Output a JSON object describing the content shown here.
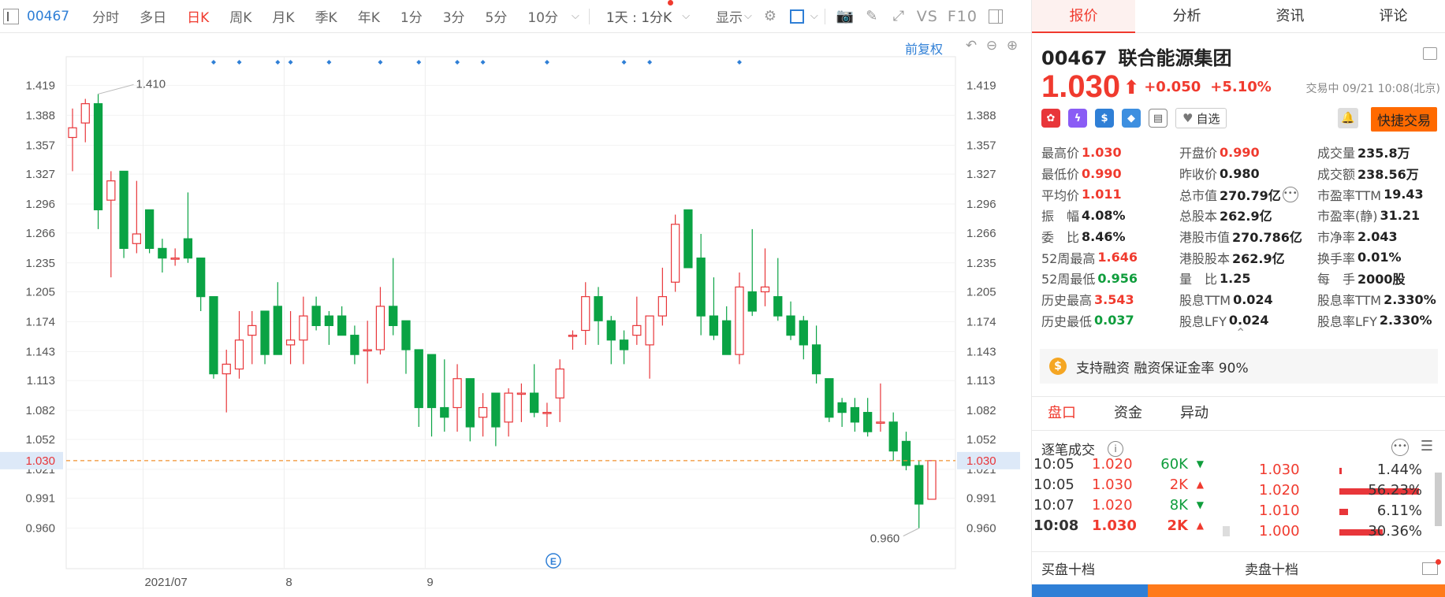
{
  "toolbar": {
    "stock_code": "00467",
    "tabs": [
      "分时",
      "多日",
      "日K",
      "周K",
      "月K",
      "季K",
      "年K",
      "1分",
      "3分",
      "5分",
      "10分"
    ],
    "active_tab": "日K",
    "period_select": "1天 : 1分K",
    "display_label": "显示",
    "vs_label": "VS",
    "f10_label": "F10"
  },
  "chart_header": {
    "adjust_label": "前复权"
  },
  "chart_data": {
    "type": "candlestick",
    "y_ticks": [
      "1.419",
      "1.388",
      "1.357",
      "1.327",
      "1.296",
      "1.266",
      "1.235",
      "1.205",
      "1.174",
      "1.143",
      "1.113",
      "1.082",
      "1.052",
      "1.021",
      "0.991",
      "0.960"
    ],
    "ylim": [
      0.945,
      1.434
    ],
    "x_labels": [
      {
        "label": "2021/07",
        "index": 6
      },
      {
        "label": "8",
        "index": 17
      },
      {
        "label": "9",
        "index": 28
      }
    ],
    "current_price": "1.030",
    "max_label": "1.410",
    "min_label": "0.960",
    "event_marker": "E",
    "up_color": "#e8363a",
    "down_color": "#0aa344",
    "candles": [
      {
        "o": 1.365,
        "h": 1.395,
        "l": 1.33,
        "c": 1.375
      },
      {
        "o": 1.38,
        "h": 1.405,
        "l": 1.36,
        "c": 1.4
      },
      {
        "o": 1.4,
        "h": 1.41,
        "l": 1.27,
        "c": 1.29
      },
      {
        "o": 1.3,
        "h": 1.33,
        "l": 1.22,
        "c": 1.32
      },
      {
        "o": 1.33,
        "h": 1.33,
        "l": 1.24,
        "c": 1.25
      },
      {
        "o": 1.255,
        "h": 1.32,
        "l": 1.245,
        "c": 1.265
      },
      {
        "o": 1.29,
        "h": 1.29,
        "l": 1.245,
        "c": 1.25
      },
      {
        "o": 1.25,
        "h": 1.26,
        "l": 1.225,
        "c": 1.24
      },
      {
        "o": 1.24,
        "h": 1.25,
        "l": 1.232,
        "c": 1.24
      },
      {
        "o": 1.26,
        "h": 1.308,
        "l": 1.235,
        "c": 1.24
      },
      {
        "o": 1.24,
        "h": 1.24,
        "l": 1.185,
        "c": 1.2
      },
      {
        "o": 1.2,
        "h": 1.2,
        "l": 1.115,
        "c": 1.12
      },
      {
        "o": 1.12,
        "h": 1.145,
        "l": 1.08,
        "c": 1.13
      },
      {
        "o": 1.125,
        "h": 1.185,
        "l": 1.115,
        "c": 1.155
      },
      {
        "o": 1.16,
        "h": 1.185,
        "l": 1.13,
        "c": 1.17
      },
      {
        "o": 1.185,
        "h": 1.185,
        "l": 1.13,
        "c": 1.14
      },
      {
        "o": 1.19,
        "h": 1.215,
        "l": 1.14,
        "c": 1.14
      },
      {
        "o": 1.15,
        "h": 1.185,
        "l": 1.13,
        "c": 1.155
      },
      {
        "o": 1.155,
        "h": 1.2,
        "l": 1.13,
        "c": 1.18
      },
      {
        "o": 1.19,
        "h": 1.2,
        "l": 1.165,
        "c": 1.17
      },
      {
        "o": 1.18,
        "h": 1.185,
        "l": 1.15,
        "c": 1.17
      },
      {
        "o": 1.18,
        "h": 1.19,
        "l": 1.16,
        "c": 1.16
      },
      {
        "o": 1.16,
        "h": 1.17,
        "l": 1.13,
        "c": 1.14
      },
      {
        "o": 1.145,
        "h": 1.175,
        "l": 1.11,
        "c": 1.145
      },
      {
        "o": 1.145,
        "h": 1.21,
        "l": 1.14,
        "c": 1.19
      },
      {
        "o": 1.19,
        "h": 1.24,
        "l": 1.16,
        "c": 1.17
      },
      {
        "o": 1.175,
        "h": 1.175,
        "l": 1.12,
        "c": 1.145
      },
      {
        "o": 1.145,
        "h": 1.145,
        "l": 1.065,
        "c": 1.085
      },
      {
        "o": 1.14,
        "h": 1.14,
        "l": 1.055,
        "c": 1.085
      },
      {
        "o": 1.085,
        "h": 1.135,
        "l": 1.06,
        "c": 1.075
      },
      {
        "o": 1.085,
        "h": 1.13,
        "l": 1.06,
        "c": 1.115
      },
      {
        "o": 1.115,
        "h": 1.115,
        "l": 1.05,
        "c": 1.065
      },
      {
        "o": 1.075,
        "h": 1.1,
        "l": 1.055,
        "c": 1.085
      },
      {
        "o": 1.1,
        "h": 1.1,
        "l": 1.045,
        "c": 1.065
      },
      {
        "o": 1.07,
        "h": 1.105,
        "l": 1.055,
        "c": 1.1
      },
      {
        "o": 1.1,
        "h": 1.11,
        "l": 1.07,
        "c": 1.1
      },
      {
        "o": 1.1,
        "h": 1.13,
        "l": 1.075,
        "c": 1.08
      },
      {
        "o": 1.08,
        "h": 1.09,
        "l": 1.065,
        "c": 1.08
      },
      {
        "o": 1.095,
        "h": 1.135,
        "l": 1.07,
        "c": 1.125
      },
      {
        "o": 1.16,
        "h": 1.165,
        "l": 1.145,
        "c": 1.16
      },
      {
        "o": 1.165,
        "h": 1.215,
        "l": 1.15,
        "c": 1.2
      },
      {
        "o": 1.2,
        "h": 1.21,
        "l": 1.15,
        "c": 1.175
      },
      {
        "o": 1.175,
        "h": 1.18,
        "l": 1.13,
        "c": 1.155
      },
      {
        "o": 1.155,
        "h": 1.165,
        "l": 1.13,
        "c": 1.145
      },
      {
        "o": 1.16,
        "h": 1.2,
        "l": 1.15,
        "c": 1.17
      },
      {
        "o": 1.15,
        "h": 1.18,
        "l": 1.115,
        "c": 1.18
      },
      {
        "o": 1.18,
        "h": 1.23,
        "l": 1.17,
        "c": 1.2
      },
      {
        "o": 1.215,
        "h": 1.285,
        "l": 1.205,
        "c": 1.275
      },
      {
        "o": 1.29,
        "h": 1.29,
        "l": 1.23,
        "c": 1.23
      },
      {
        "o": 1.24,
        "h": 1.265,
        "l": 1.16,
        "c": 1.18
      },
      {
        "o": 1.18,
        "h": 1.22,
        "l": 1.155,
        "c": 1.16
      },
      {
        "o": 1.175,
        "h": 1.19,
        "l": 1.14,
        "c": 1.14
      },
      {
        "o": 1.14,
        "h": 1.225,
        "l": 1.13,
        "c": 1.21
      },
      {
        "o": 1.205,
        "h": 1.27,
        "l": 1.18,
        "c": 1.185
      },
      {
        "o": 1.205,
        "h": 1.25,
        "l": 1.19,
        "c": 1.21
      },
      {
        "o": 1.2,
        "h": 1.24,
        "l": 1.175,
        "c": 1.18
      },
      {
        "o": 1.18,
        "h": 1.195,
        "l": 1.155,
        "c": 1.16
      },
      {
        "o": 1.175,
        "h": 1.18,
        "l": 1.135,
        "c": 1.15
      },
      {
        "o": 1.15,
        "h": 1.17,
        "l": 1.11,
        "c": 1.12
      },
      {
        "o": 1.115,
        "h": 1.115,
        "l": 1.07,
        "c": 1.075
      },
      {
        "o": 1.09,
        "h": 1.095,
        "l": 1.065,
        "c": 1.08
      },
      {
        "o": 1.085,
        "h": 1.095,
        "l": 1.06,
        "c": 1.07
      },
      {
        "o": 1.08,
        "h": 1.095,
        "l": 1.055,
        "c": 1.06
      },
      {
        "o": 1.07,
        "h": 1.11,
        "l": 1.06,
        "c": 1.07
      },
      {
        "o": 1.07,
        "h": 1.08,
        "l": 1.03,
        "c": 1.04
      },
      {
        "o": 1.05,
        "h": 1.06,
        "l": 1.02,
        "c": 1.025
      },
      {
        "o": 1.025,
        "h": 1.03,
        "l": 0.96,
        "c": 0.985
      },
      {
        "o": 0.99,
        "h": 1.03,
        "l": 0.99,
        "c": 1.03
      }
    ]
  },
  "quote": {
    "code": "00467",
    "name": "联合能源集团",
    "price": "1.030",
    "change": "+0.050",
    "change_pct": "+5.10%",
    "status": "交易中 09/21 10:08(北京)",
    "watch_label": "自选",
    "fast_trade_label": "快捷交易"
  },
  "stats": [
    [
      {
        "label": "最高价",
        "value": "1.030",
        "color": "red"
      },
      {
        "label": "开盘价",
        "value": "0.990",
        "color": "red"
      },
      {
        "label": "成交量",
        "value": "235.8万",
        "color": "black"
      }
    ],
    [
      {
        "label": "最低价",
        "value": "0.990",
        "color": "red"
      },
      {
        "label": "昨收价",
        "value": "0.980",
        "color": "black"
      },
      {
        "label": "成交额",
        "value": "238.56万",
        "color": "black"
      }
    ],
    [
      {
        "label": "平均价",
        "value": "1.011",
        "color": "red"
      },
      {
        "label": "总市值",
        "value": "270.79亿",
        "color": "black"
      },
      {
        "label": "市盈率TTM",
        "value": "19.43",
        "color": "black"
      }
    ],
    [
      {
        "label": "振　幅",
        "value": "4.08%",
        "color": "black"
      },
      {
        "label": "总股本",
        "value": "262.9亿",
        "color": "black"
      },
      {
        "label": "市盈率(静)",
        "value": "31.21",
        "color": "black"
      }
    ],
    [
      {
        "label": "委　比",
        "value": "8.46%",
        "color": "black"
      },
      {
        "label": "港股市值",
        "value": "270.786亿",
        "color": "black"
      },
      {
        "label": "市净率",
        "value": "2.043",
        "color": "black"
      }
    ],
    [
      {
        "label": "52周最高",
        "value": "1.646",
        "color": "red"
      },
      {
        "label": "港股股本",
        "value": "262.9亿",
        "color": "black"
      },
      {
        "label": "换手率",
        "value": "0.01%",
        "color": "black"
      }
    ],
    [
      {
        "label": "52周最低",
        "value": "0.956",
        "color": "green"
      },
      {
        "label": "量　比",
        "value": "1.25",
        "color": "black"
      },
      {
        "label": "每　手",
        "value": "2000股",
        "color": "black"
      }
    ],
    [
      {
        "label": "历史最高",
        "value": "3.543",
        "color": "red"
      },
      {
        "label": "股息TTM",
        "value": "0.024",
        "color": "black"
      },
      {
        "label": "股息率TTM",
        "value": "2.330%",
        "color": "black"
      }
    ],
    [
      {
        "label": "历史最低",
        "value": "0.037",
        "color": "green"
      },
      {
        "label": "股息LFY",
        "value": "0.024",
        "color": "black"
      },
      {
        "label": "股息率LFY",
        "value": "2.330%",
        "color": "black"
      }
    ]
  ],
  "margin_text": "支持融资 融资保证金率 90%",
  "right_tabs": [
    "报价",
    "分析",
    "资讯",
    "评论"
  ],
  "sub_tabs": [
    "盘口",
    "资金",
    "异动"
  ],
  "tick_title": "逐笔成交",
  "ticks": [
    {
      "time": "10:05",
      "price": "1.020",
      "vol": "60K",
      "dir": "down"
    },
    {
      "time": "10:05",
      "price": "1.030",
      "vol": "2K",
      "dir": "up"
    },
    {
      "time": "10:07",
      "price": "1.020",
      "vol": "8K",
      "dir": "down"
    },
    {
      "time": "10:08",
      "price": "1.030",
      "vol": "2K",
      "dir": "up"
    }
  ],
  "price_dist": [
    {
      "price": "1.030",
      "pct": "1.44%",
      "ratio": 0.0144
    },
    {
      "price": "1.020",
      "pct": "56.23%",
      "ratio": 0.5623
    },
    {
      "price": "1.010",
      "pct": "6.11%",
      "ratio": 0.0611
    },
    {
      "price": "1.000",
      "pct": "30.36%",
      "ratio": 0.3036
    }
  ],
  "orderbook": {
    "bid_label": "买盘十档",
    "ask_label": "卖盘十档",
    "bid_ratio": 0.28
  }
}
